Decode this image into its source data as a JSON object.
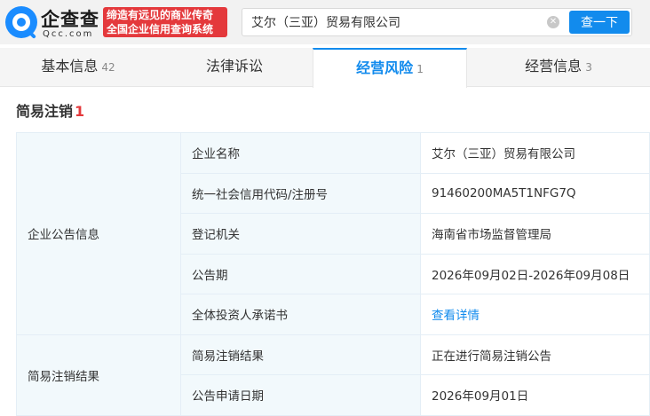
{
  "header": {
    "logo_name": "企查查",
    "logo_domain": "Qcc.com",
    "slogan_line1": "缔造有远见的商业传奇",
    "slogan_line2": "全国企业信用查询系统",
    "search_value": "艾尔（三亚）贸易有限公司",
    "clear_glyph": "✕",
    "search_button": "查一下"
  },
  "tabs": [
    {
      "label": "基本信息",
      "count": "42",
      "active": false
    },
    {
      "label": "法律诉讼",
      "count": "",
      "active": false
    },
    {
      "label": "经营风险",
      "count": "1",
      "active": true
    },
    {
      "label": "经营信息",
      "count": "3",
      "active": false
    }
  ],
  "section": {
    "title": "简易注销",
    "count": "1"
  },
  "table": {
    "group1": "企业公告信息",
    "group2": "简易注销结果",
    "rows": [
      {
        "label": "企业名称",
        "value": "艾尔（三亚）贸易有限公司"
      },
      {
        "label": "统一社会信用代码/注册号",
        "value": "91460200MA5T1NFG7Q"
      },
      {
        "label": "登记机关",
        "value": "海南省市场监督管理局"
      },
      {
        "label": "公告期",
        "value": "2026年09月02日-2026年09月08日"
      },
      {
        "label": "全体投资人承诺书",
        "value": "查看详情"
      },
      {
        "label": "简易注销结果",
        "value": "正在进行简易注销公告"
      },
      {
        "label": "公告申请日期",
        "value": "2026年09月01日"
      }
    ]
  },
  "colors": {
    "accent": "#128bed",
    "brand_red": "#e4393c",
    "label_bg": "#f2f9fc"
  }
}
